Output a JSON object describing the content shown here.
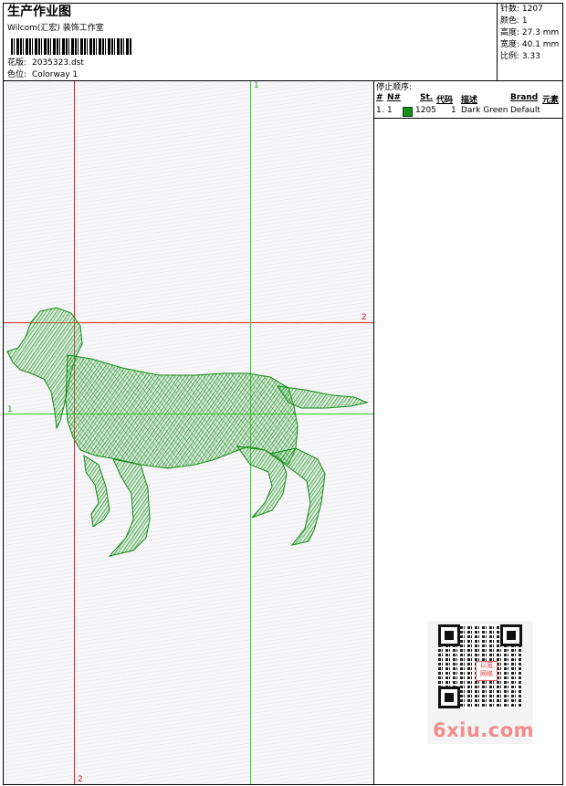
{
  "header": {
    "title": "生产作业图",
    "company": "Wilcom(汇宏) 装饰工作室",
    "design_label": "花版:",
    "design_value": "2035323.dst",
    "colorway_label": "色位:",
    "colorway_value": "Colorway 1"
  },
  "stats": {
    "stitches": "针数: 1207",
    "colors": "颜色: 1",
    "height": "高度: 27.3 mm",
    "width": "宽度: 40.1 mm",
    "scale": "比例: 3.33"
  },
  "stop_sequence": {
    "title": "停止顺序:",
    "headers": [
      "#",
      "N#",
      "St.",
      "代码",
      "描述",
      "Brand",
      "元素"
    ],
    "rows": [
      {
        "idx": "1.",
        "n": "1",
        "stitches": "1205",
        "code": "1",
        "desc": "Dark Green",
        "brand": "Default",
        "swatch": "#1a8c1a"
      }
    ]
  },
  "guides": {
    "red_top": "1",
    "red_right": "2",
    "green_left": "1",
    "red_bottom": "2"
  },
  "watermark": {
    "logo_text": "以宽 网络",
    "site": "6xiu.com"
  },
  "colors": {
    "thread": "#1a8c1a",
    "red_guide": "#e32020",
    "green_guide": "#27d427"
  }
}
